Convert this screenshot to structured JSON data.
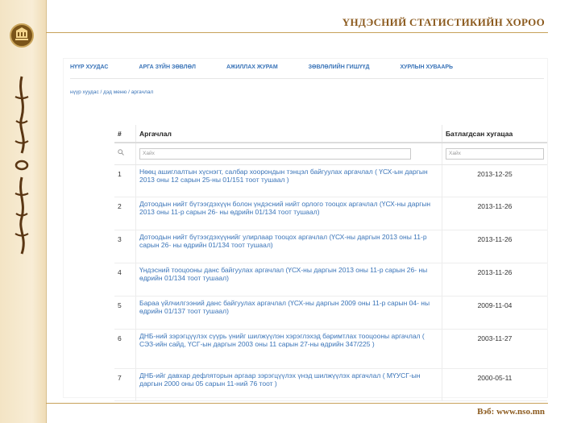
{
  "header": {
    "title": "ҮНДЭСНИЙ СТАТИСТИКИЙН ХОРОО"
  },
  "footer": {
    "web": "Вэб: www.nso.mn"
  },
  "side": {
    "logo_icon": "nso-emblem-icon",
    "script_icon": "mongolian-script-icon"
  },
  "nav": {
    "items": [
      "НҮҮР ХУУДАС",
      "АРГА ЗҮЙН ЗӨВЛӨЛ",
      "АЖИЛЛАХ ЖУРАМ",
      "ЗӨВЛӨЛИЙН ГИШҮҮД",
      "ХУРЛЫН ХУВААРЬ"
    ]
  },
  "breadcrumb": "нүүр хуудас / дэд меню / аргачлал",
  "table": {
    "headers": {
      "num": "#",
      "desc": "Аргачлал",
      "date": "Батлагдсан хугацаа"
    },
    "filter": {
      "desc_placeholder": "Хайх",
      "date_placeholder": "Хайх"
    },
    "rows": [
      {
        "num": "1",
        "desc": "Нөөц ашиглалтын хүснэгт, салбар хоорондын тэнцэл байгуулах аргачлал ( ҮСХ-ын даргын 2013 оны 12 сарын 25-ны 01/151 тоот тушаал )",
        "date": "2013-12-25"
      },
      {
        "num": "2",
        "desc": "Дотоодын нийт бүтээгдэхүүн болон үндэсний нийт орлого тооцох аргачлал (ҮСХ-ны даргын 2013 оны 11-р сарын 26- ны өдрийн 01/134 тоот тушаал)",
        "date": "2013-11-26"
      },
      {
        "num": "3",
        "desc": "Дотоодын нийт бүтээгдэхүүнийг улирлаар тооцох аргачлал (ҮСХ-ны даргын 2013 оны 11-р сарын 26- ны өдрийн 01/134 тоот тушаал)",
        "date": "2013-11-26"
      },
      {
        "num": "4",
        "desc": "Үндэсний тооцооны данс байгуулах аргачлал (ҮСХ-ны даргын 2013 оны 11-р сарын 26- ны өдрийн 01/134 тоот тушаал)",
        "date": "2013-11-26"
      },
      {
        "num": "5",
        "desc": "Бараа үйлчилгээний данс байгуулах аргачлал (ҮСХ-ны даргын 2009 оны 11-р сарын 04- ны өдрийн 01/137 тоот тушаал)",
        "date": "2009-11-04"
      },
      {
        "num": "6",
        "desc": "ДНБ-ний зэрэгцүүлэх сүүрь үнийг шилжүүлэн хэрэглэхэд баримтлах тооцооны аргачлал ( СЭЗ-ийн сайд, ҮСГ-ын даргын 2003 оны 11 сарын 27-ны өдрийн 347/225 )",
        "date": "2003-11-27"
      },
      {
        "num": "7",
        "desc": "ДНБ-ийг давхар дефляторын аргаар зэрэгцүүлэх үнэд шилжүүлэх аргачлал ( МҮУСГ-ын даргын 2000 оны 05 сарын 11-ний 76 тоот )",
        "date": "2000-05-11"
      }
    ]
  }
}
